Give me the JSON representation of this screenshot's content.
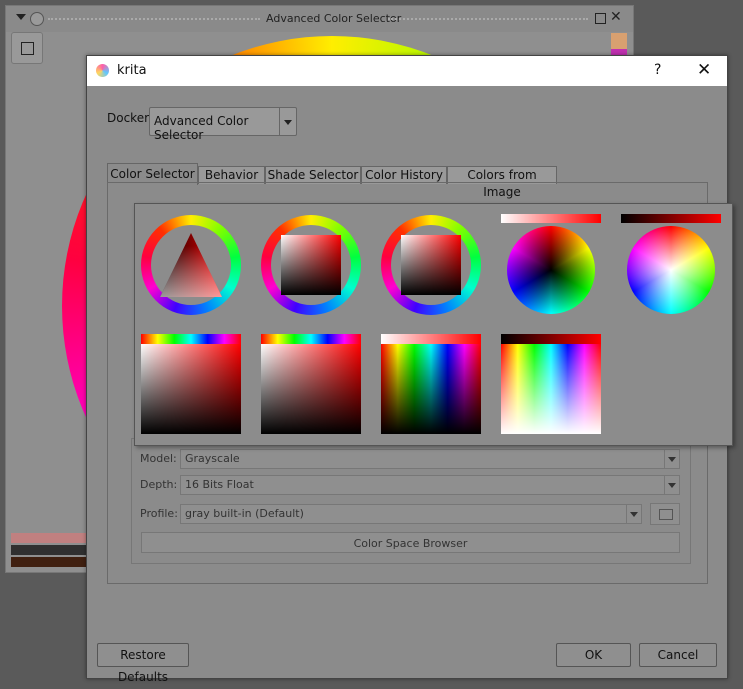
{
  "docker": {
    "title": "Advanced Color Selector",
    "colors": {
      "swatch_top": "#d8a070",
      "swatch_bottom": "#c030b0",
      "bar1": "#c08080",
      "bar2": "#303030",
      "bar3": "#402010"
    }
  },
  "dialog": {
    "app_name": "krita",
    "help": "?",
    "close": "✕",
    "docker_label": "Docker:",
    "docker_value": "Advanced Color Selector",
    "tabs": [
      "Color Selector",
      "Behavior",
      "Shade Selector",
      "Color History",
      "Colors from Image"
    ],
    "active_tab": "Color Selector",
    "color_space": {
      "model_label": "Model:",
      "model_value": "Grayscale",
      "depth_label": "Depth:",
      "depth_value": "16 Bits Float",
      "profile_label": "Profile:",
      "profile_value": "gray built-in (Default)",
      "browser_button": "Color Space Browser"
    },
    "buttons": {
      "restore": "Restore Defaults",
      "ok": "OK",
      "cancel": "Cancel"
    }
  },
  "selector_types": [
    {
      "name": "triangle-ring-selector",
      "icon": "hue-ring-triangle"
    },
    {
      "name": "square-ring-selector",
      "icon": "hue-ring-square"
    },
    {
      "name": "square-ring-selector-alt",
      "icon": "hue-ring-square"
    },
    {
      "name": "wheel-dark-selector",
      "icon": "hue-wheel-with-bar"
    },
    {
      "name": "wheel-light-selector",
      "icon": "hue-wheel-with-bar"
    },
    {
      "name": "plane-hue-top-selector",
      "icon": "square-with-hue-bar"
    },
    {
      "name": "plane-hue-top-selector-2",
      "icon": "square-with-hue-bar"
    },
    {
      "name": "hue-plane-dark-selector",
      "icon": "hue-plane"
    },
    {
      "name": "hue-plane-light-selector",
      "icon": "hue-plane"
    }
  ]
}
